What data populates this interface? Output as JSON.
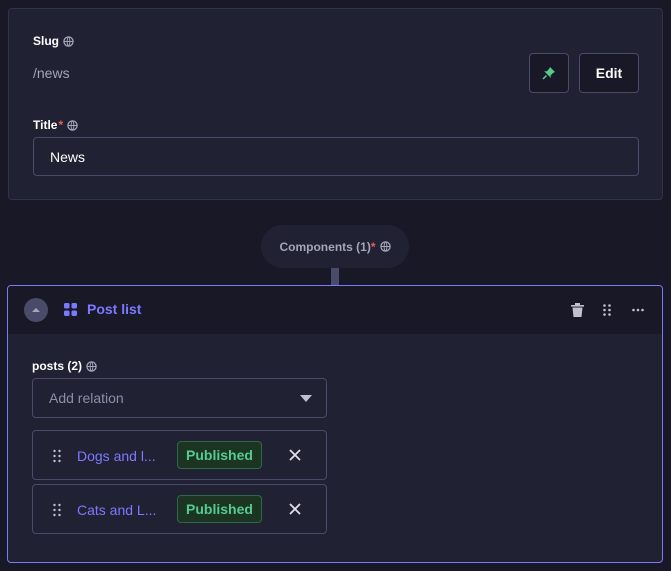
{
  "slug": {
    "label": "Slug",
    "value": "/news",
    "pin_icon": "pin-icon",
    "edit_label": "Edit"
  },
  "title_field": {
    "label": "Title",
    "required_mark": "*",
    "value": "News"
  },
  "components": {
    "label": "Components (1)",
    "required_mark": "*"
  },
  "component": {
    "name": "Post list",
    "icons": [
      "chevron-up-icon",
      "component-grid-icon",
      "trash-icon",
      "drag-icon",
      "more-icon"
    ],
    "posts_label": "posts (2)",
    "relation_placeholder": "Add relation",
    "relations": [
      {
        "title": "Dogs and l...",
        "status": "Published"
      },
      {
        "title": "Cats and L...",
        "status": "Published"
      }
    ]
  },
  "colors": {
    "accent": "#7b79ff",
    "published_text": "#55cb8d",
    "required": "#ee5e52",
    "pin": "#55cb8d"
  }
}
